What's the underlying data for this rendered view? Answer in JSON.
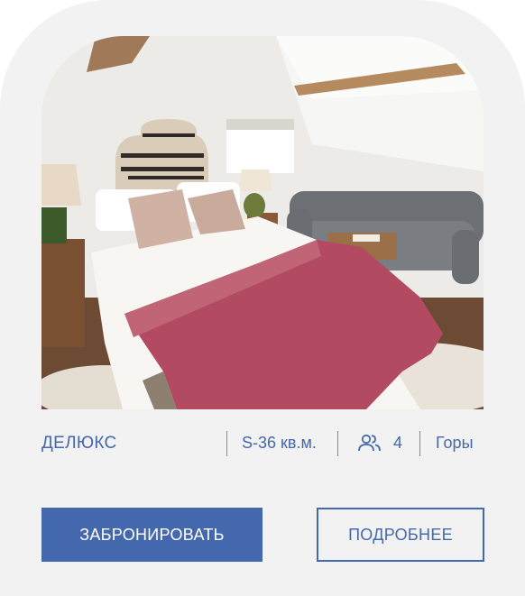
{
  "room": {
    "type": "ДЕЛЮКС",
    "size": "S-36 кв.м.",
    "guests_icon": "users-icon",
    "guests": "4",
    "view": "Горы"
  },
  "actions": {
    "book_label": "ЗАБРОНИРОВАТЬ",
    "details_label": "ПОДРОБНЕЕ"
  },
  "colors": {
    "accent": "#4468ad",
    "card_background": "#f2f2f2"
  }
}
